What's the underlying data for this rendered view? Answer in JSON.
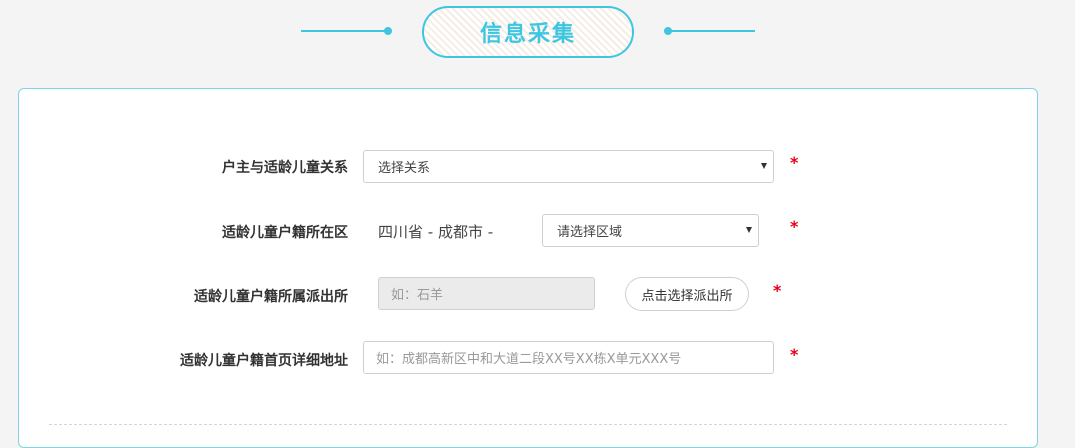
{
  "header": {
    "title": "信息采集"
  },
  "form": {
    "relationship": {
      "label": "户主与适龄儿童关系",
      "selected": "选择关系",
      "required": "*"
    },
    "district": {
      "label": "适龄儿童户籍所在区",
      "prefix": "四川省 - 成都市 -",
      "selected": "请选择区域",
      "required": "*"
    },
    "police_station": {
      "label": "适龄儿童户籍所属派出所",
      "placeholder": "如：石羊",
      "button_label": "点击选择派出所",
      "required": "*"
    },
    "address": {
      "label": "适龄儿童户籍首页详细地址",
      "placeholder": "如：成都高新区中和大道二段XX号XX栋X单元XXX号",
      "required": "*"
    }
  },
  "colors": {
    "accent": "#3ec6e0",
    "required": "#e60012"
  }
}
